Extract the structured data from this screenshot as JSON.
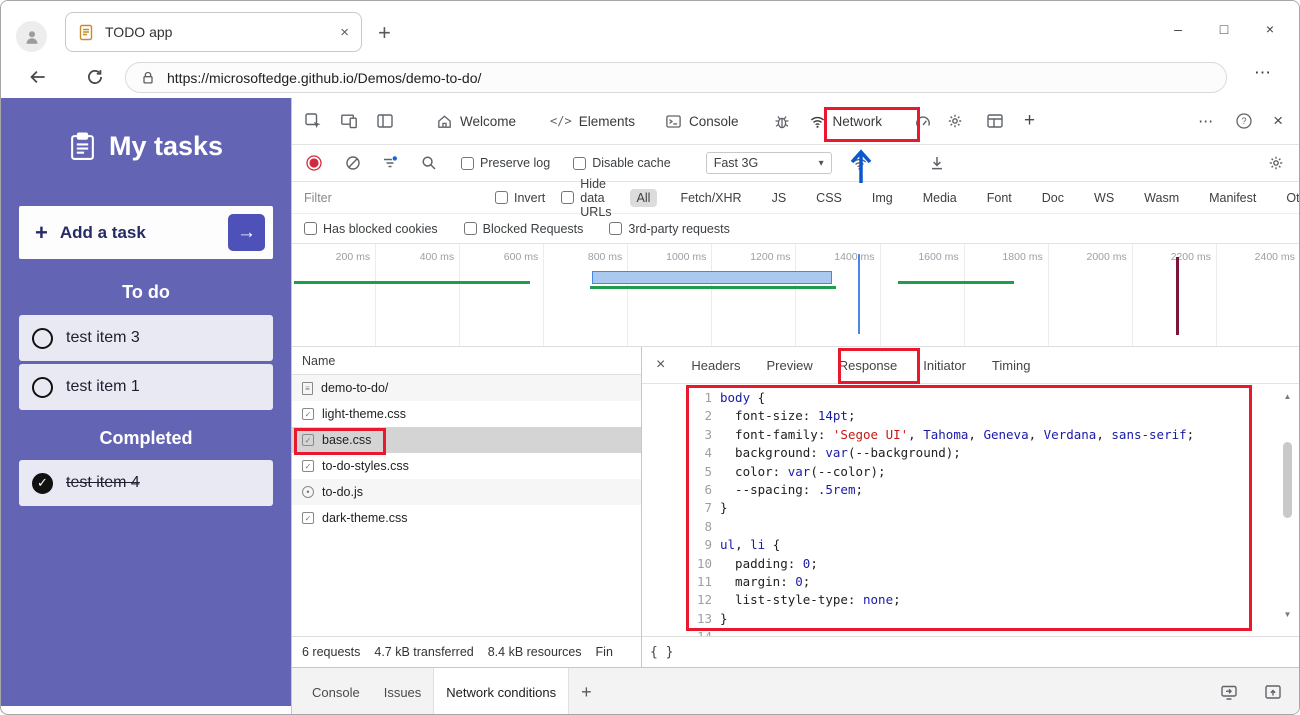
{
  "colors": {
    "annotation_red": "#e8192c",
    "annotation_blue": "#0b57d0",
    "todo_purple": "#6365b4",
    "accent_blue_button": "#4d51b8",
    "timeline_green": "#1e9e4a",
    "timeline_blue_fill": "#abc8ef",
    "timeline_blue_stroke": "#4a85e8",
    "timeline_marker_red": "#7c1637",
    "selected_row": "#d4d4d4"
  },
  "glyphs": {
    "plus": "+",
    "close_x": "×",
    "minimize": "–",
    "maximize": "□",
    "ellipsis": "⋯",
    "help": "?",
    "caret_down": "▾",
    "arrow_right": "→",
    "check": "✓",
    "elements_tag": "</>",
    "scroll_up": "▲",
    "scroll_down": "▼"
  },
  "chrome": {
    "tab_title": "TODO app",
    "url": "https://microsoftedge.github.io/Demos/demo-to-do/"
  },
  "todo": {
    "title": "My tasks",
    "add_task": "Add a task",
    "todo_heading": "To do",
    "completed_heading": "Completed",
    "todo_items": [
      "test item 3",
      "test item 1"
    ],
    "completed_items": [
      "test item 4"
    ]
  },
  "devtools": {
    "main_tabs": {
      "welcome": "Welcome",
      "elements": "Elements",
      "console": "Console",
      "network": "Network"
    },
    "net_toolbar": {
      "preserve_log": "Preserve log",
      "disable_cache": "Disable cache",
      "throttling_value": "Fast 3G"
    },
    "filter": {
      "placeholder": "Filter",
      "invert": "Invert",
      "hide_data_urls": "Hide data URLs",
      "pills": [
        "All",
        "Fetch/XHR",
        "JS",
        "CSS",
        "Img",
        "Media",
        "Font",
        "Doc",
        "WS",
        "Wasm",
        "Manifest",
        "Other"
      ],
      "selected_pill": "All",
      "row2": [
        "Has blocked cookies",
        "Blocked Requests",
        "3rd-party requests"
      ]
    },
    "timeline": {
      "ticks": [
        "200 ms",
        "400 ms",
        "600 ms",
        "800 ms",
        "1000 ms",
        "1200 ms",
        "1400 ms",
        "1600 ms",
        "1800 ms",
        "2000 ms",
        "2200 ms",
        "2400 ms"
      ]
    },
    "requests": {
      "name_header": "Name",
      "rows": [
        {
          "name": "demo-to-do/",
          "icon": "document",
          "selected": false
        },
        {
          "name": "light-theme.css",
          "icon": "stylesheet",
          "selected": false
        },
        {
          "name": "base.css",
          "icon": "stylesheet",
          "selected": true
        },
        {
          "name": "to-do-styles.css",
          "icon": "stylesheet",
          "selected": false
        },
        {
          "name": "to-do.js",
          "icon": "script",
          "selected": false
        },
        {
          "name": "dark-theme.css",
          "icon": "stylesheet",
          "selected": false
        }
      ],
      "summary": [
        "6 requests",
        "4.7 kB transferred",
        "8.4 kB resources",
        "Fin"
      ]
    },
    "detail": {
      "tabs": [
        "Headers",
        "Preview",
        "Response",
        "Initiator",
        "Timing"
      ],
      "selected_tab": "Response",
      "format_button": "{ }",
      "code_lines": [
        [
          [
            "k",
            "body"
          ],
          [
            "t",
            " {"
          ]
        ],
        [
          [
            "t",
            "  font-size: "
          ],
          [
            "k",
            "14pt"
          ],
          [
            "t",
            ";"
          ]
        ],
        [
          [
            "t",
            "  font-family: "
          ],
          [
            "s",
            "'Segoe UI'"
          ],
          [
            "t",
            ", "
          ],
          [
            "k",
            "Tahoma"
          ],
          [
            "t",
            ", "
          ],
          [
            "k",
            "Geneva"
          ],
          [
            "t",
            ", "
          ],
          [
            "k",
            "Verdana"
          ],
          [
            "t",
            ", "
          ],
          [
            "k",
            "sans-serif"
          ],
          [
            "t",
            ";"
          ]
        ],
        [
          [
            "t",
            "  background: "
          ],
          [
            "k",
            "var"
          ],
          [
            "t",
            "(--background);"
          ]
        ],
        [
          [
            "t",
            "  color: "
          ],
          [
            "k",
            "var"
          ],
          [
            "t",
            "(--color);"
          ]
        ],
        [
          [
            "t",
            "  --spacing: "
          ],
          [
            "k",
            ".5rem"
          ],
          [
            "t",
            ";"
          ]
        ],
        [
          [
            "t",
            "}"
          ]
        ],
        [],
        [
          [
            "k",
            "ul"
          ],
          [
            "t",
            ", "
          ],
          [
            "k",
            "li"
          ],
          [
            "t",
            " {"
          ]
        ],
        [
          [
            "t",
            "  padding: "
          ],
          [
            "k",
            "0"
          ],
          [
            "t",
            ";"
          ]
        ],
        [
          [
            "t",
            "  margin: "
          ],
          [
            "k",
            "0"
          ],
          [
            "t",
            ";"
          ]
        ],
        [
          [
            "t",
            "  list-style-type: "
          ],
          [
            "k",
            "none"
          ],
          [
            "t",
            ";"
          ]
        ],
        [
          [
            "t",
            "}"
          ]
        ],
        []
      ]
    },
    "drawer": {
      "tabs": [
        "Console",
        "Issues",
        "Network conditions"
      ],
      "selected_tab": "Network conditions"
    }
  }
}
